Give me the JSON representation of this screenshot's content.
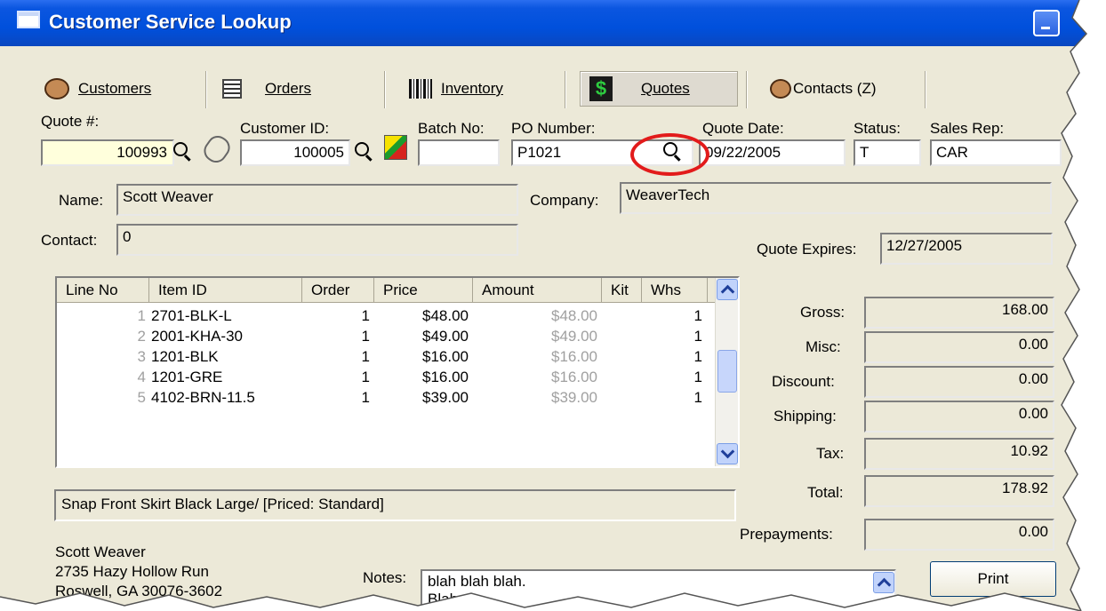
{
  "window": {
    "title": "Customer Service Lookup"
  },
  "tabs": [
    {
      "label": "Customers",
      "icon": "customers-icon"
    },
    {
      "label": "Orders",
      "icon": "orders-icon"
    },
    {
      "label": "Inventory",
      "icon": "inventory-icon"
    },
    {
      "label": "Quotes",
      "icon": "quotes-icon"
    },
    {
      "label": "Contacts (Z)",
      "icon": "contacts-icon"
    }
  ],
  "header": {
    "quote_no_label": "Quote #:",
    "quote_no": "100993",
    "customer_id_label": "Customer ID:",
    "customer_id": "100005",
    "batch_no_label": "Batch No:",
    "batch_no": "",
    "po_number_label": "PO Number:",
    "po_number": "P1021",
    "quote_date_label": "Quote Date:",
    "quote_date": "09/22/2005",
    "status_label": "Status:",
    "status": "T",
    "sales_rep_label": "Sales Rep:",
    "sales_rep": "CAR"
  },
  "customer": {
    "name_label": "Name:",
    "name": "Scott Weaver",
    "company_label": "Company:",
    "company": "WeaverTech",
    "contact_label": "Contact:",
    "contact": "0",
    "quote_expires_label": "Quote Expires:",
    "quote_expires": "12/27/2005"
  },
  "lines": {
    "columns": [
      "Line No",
      "Item ID",
      "Order",
      "Price",
      "Amount",
      "Kit",
      "Whs"
    ],
    "rows": [
      {
        "line": "1",
        "item": "2701-BLK-L",
        "order": "1",
        "price": "$48.00",
        "amount": "$48.00",
        "kit": "",
        "whs": "1"
      },
      {
        "line": "2",
        "item": "2001-KHA-30",
        "order": "1",
        "price": "$49.00",
        "amount": "$49.00",
        "kit": "",
        "whs": "1"
      },
      {
        "line": "3",
        "item": "1201-BLK",
        "order": "1",
        "price": "$16.00",
        "amount": "$16.00",
        "kit": "",
        "whs": "1"
      },
      {
        "line": "4",
        "item": "1201-GRE",
        "order": "1",
        "price": "$16.00",
        "amount": "$16.00",
        "kit": "",
        "whs": "1"
      },
      {
        "line": "5",
        "item": "4102-BRN-11.5",
        "order": "1",
        "price": "$39.00",
        "amount": "$39.00",
        "kit": "",
        "whs": "1"
      }
    ]
  },
  "description": "Snap Front Skirt Black Large/ [Priced: Standard]",
  "totals": [
    {
      "label": "Gross:",
      "value": "168.00"
    },
    {
      "label": "Misc:",
      "value": "0.00"
    },
    {
      "label": "Discount:",
      "value": "0.00"
    },
    {
      "label": "Shipping:",
      "value": "0.00"
    },
    {
      "label": "Tax:",
      "value": "10.92"
    },
    {
      "label": "Total:",
      "value": "178.92"
    },
    {
      "label": "Prepayments:",
      "value": "0.00"
    }
  ],
  "address": {
    "line1": "Scott Weaver",
    "line2": "2735 Hazy Hollow Run",
    "line3": "Roswell, GA 30076-3602"
  },
  "notes": {
    "label": "Notes:",
    "line1": "blah blah blah.",
    "line2": "Blah."
  },
  "buttons": {
    "print": "Print"
  },
  "colors": {
    "title_bar": "#0050dc",
    "window_bg": "#ece9d8",
    "highlight_circle": "#e21b1b",
    "quote_field_bg": "#ffffdc"
  }
}
